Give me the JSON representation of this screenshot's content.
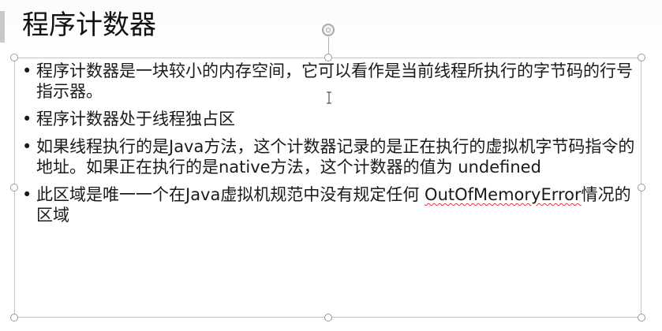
{
  "slide": {
    "title": "程序计数器",
    "bullets": [
      {
        "text": "程序计数器是一块较小的内存空间，它可以看作是当前线程所执行的字节码的行号指示器。"
      },
      {
        "text": "程序计数器处于线程独占区"
      },
      {
        "text": "如果线程执行的是Java方法，这个计数器记录的是正在执行的虚拟机字节码指令的地址。如果正在执行的是native方法，这个计数器的值为 undefined"
      },
      {
        "text_before": "此区域是唯一一个在Java虚拟机规范中没有规定任何 ",
        "text_error": "OutOfMemoryError",
        "text_after": "情况的区域"
      }
    ],
    "bullet_char": "•"
  },
  "colors": {
    "text": "#1a1a1a",
    "selection_border": "#c4c4c4",
    "spellcheck_underline": "#d9363e"
  },
  "icons": {
    "rotate": "rotate-handle-icon",
    "cursor": "text-cursor-icon"
  }
}
